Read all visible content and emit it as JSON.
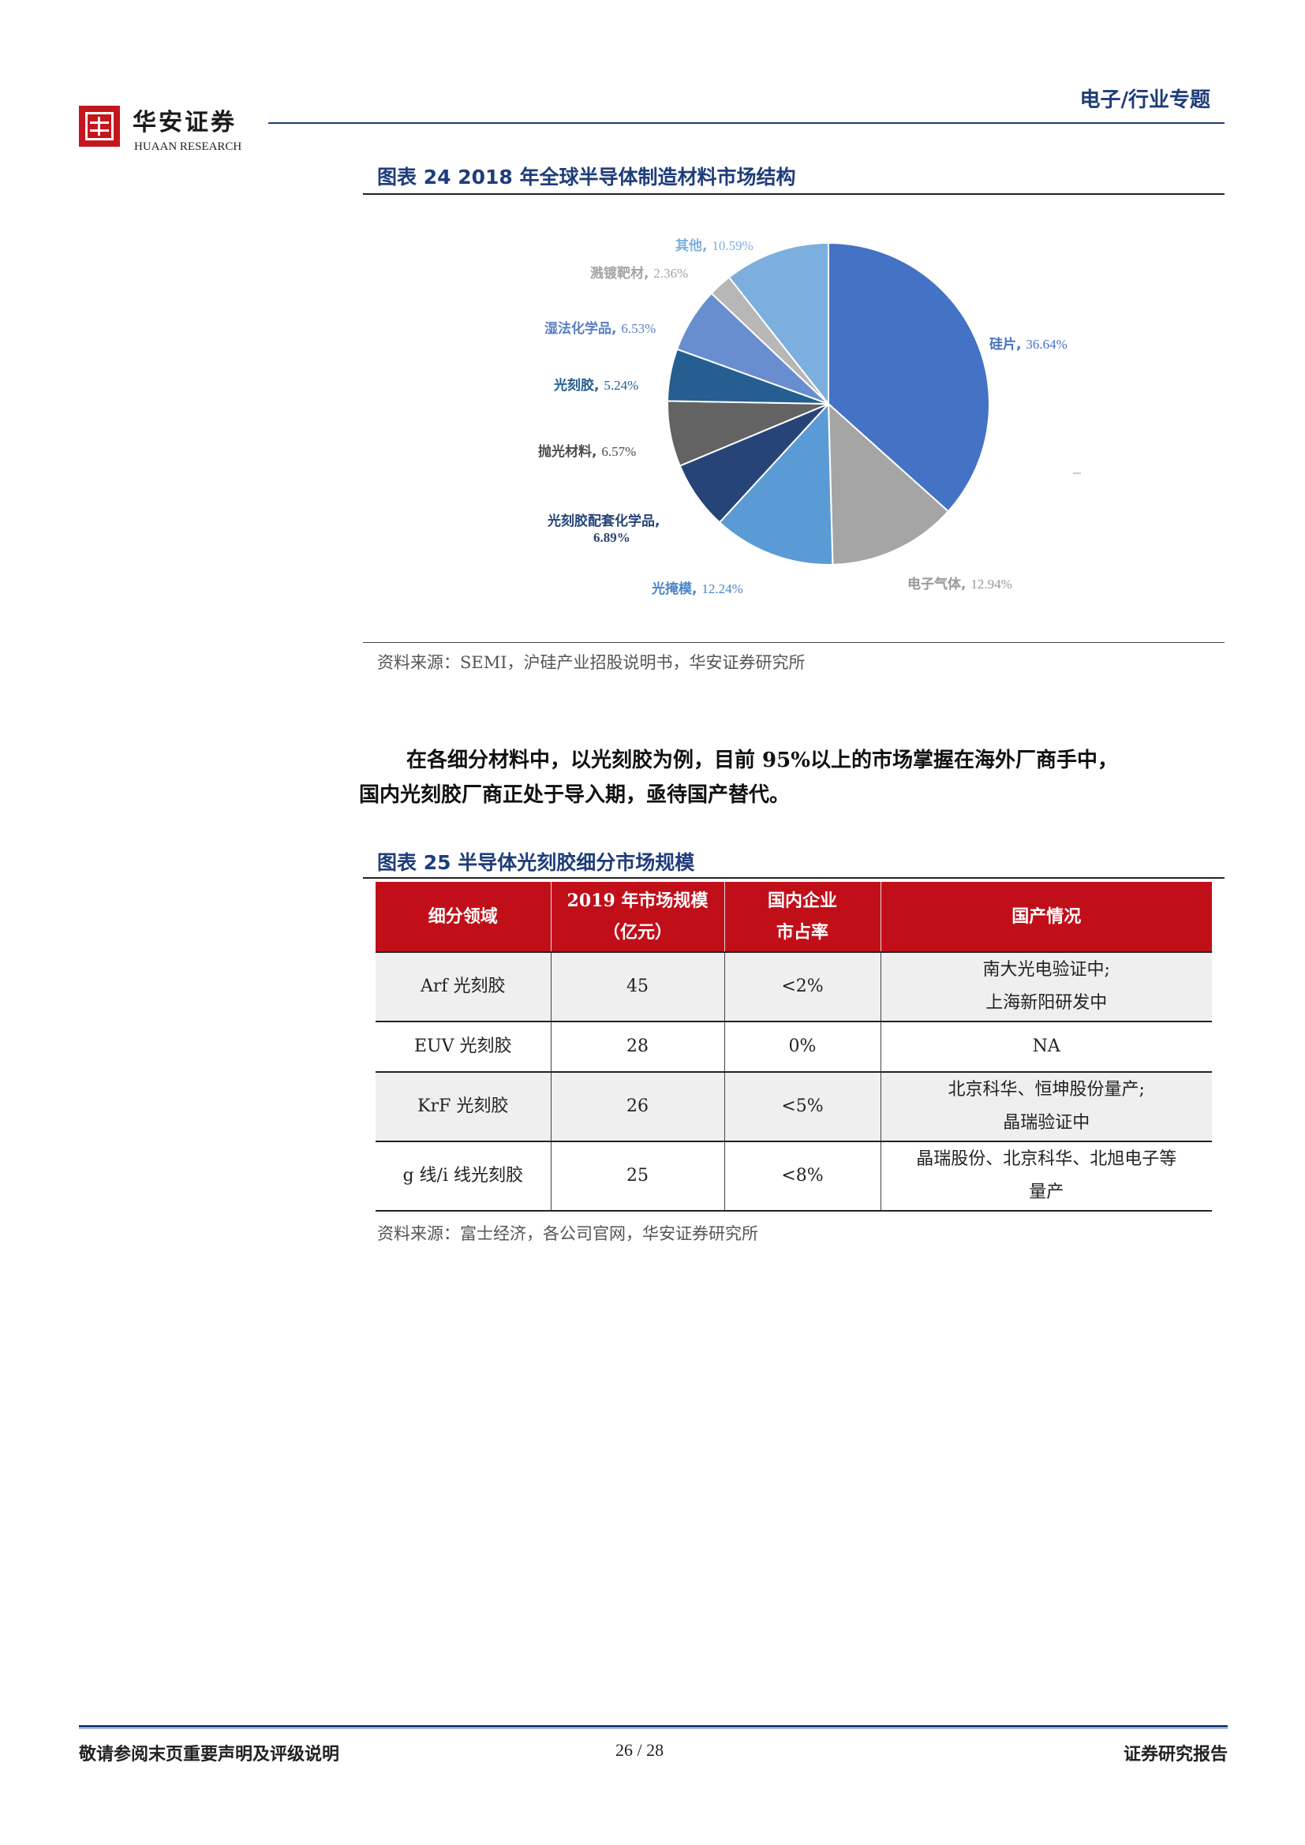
{
  "header": {
    "logo_cn": "华安证券",
    "logo_en": "HUAAN RESEARCH",
    "section": "电子/行业专题"
  },
  "figure24": {
    "title": "图表 24 2018 年全球半导体制造材料市场结构",
    "source": "资料来源：SEMI，沪硅产业招股说明书，华安证券研究所"
  },
  "chart_data": {
    "type": "pie",
    "title": "",
    "start_angle_deg": 0,
    "direction": "clockwise",
    "slices": [
      {
        "label": "硅片",
        "value": 36.64,
        "value_text": "36.64%",
        "color": "#4472c4"
      },
      {
        "label": "电子气体",
        "value": 12.94,
        "value_text": "12.94%",
        "color": "#a5a5a5"
      },
      {
        "label": "光掩模",
        "value": 12.24,
        "value_text": "12.24%",
        "color": "#5b9bd5"
      },
      {
        "label": "光刻胶配套化学品,",
        "value": 6.89,
        "value_text": "6.89%",
        "color": "#264478"
      },
      {
        "label": "抛光材料",
        "value": 6.57,
        "value_text": "6.57%",
        "color": "#636363"
      },
      {
        "label": "光刻胶",
        "value": 5.24,
        "value_text": "5.24%",
        "color": "#255e91"
      },
      {
        "label": "湿法化学品",
        "value": 6.53,
        "value_text": "6.53%",
        "color": "#698ed0"
      },
      {
        "label": "溅镀靶材",
        "value": 2.36,
        "value_text": "2.36%",
        "color": "#b7b7b7"
      },
      {
        "label": "其他",
        "value": 10.59,
        "value_text": "10.59%",
        "color": "#7cafdd"
      }
    ]
  },
  "paragraph": {
    "line1": "在各细分材料中，以光刻胶为例，目前 95%以上的市场掌握在海外厂商手中，",
    "line2": "国内光刻胶厂商正处于导入期，亟待国产替代。"
  },
  "figure25": {
    "title": "图表 25  半导体光刻胶细分市场规模",
    "source": "资料来源：富士经济，各公司官网，华安证券研究所",
    "headers": [
      [
        "细分领域"
      ],
      [
        "2019 年市场规模",
        "（亿元）"
      ],
      [
        "国内企业",
        "市占率"
      ],
      [
        "国产情况"
      ]
    ],
    "rows": [
      {
        "field": "Arf 光刻胶",
        "size": "45",
        "share": "<2%",
        "status": [
          "南大光电验证中;",
          "上海新阳研发中"
        ]
      },
      {
        "field": "EUV 光刻胶",
        "size": "28",
        "share": "0%",
        "status": [
          "NA"
        ]
      },
      {
        "field": "KrF 光刻胶",
        "size": "26",
        "share": "<5%",
        "status": [
          "北京科华、恒坤股份量产;",
          "晶瑞验证中"
        ]
      },
      {
        "field": "g 线/i  线光刻胶",
        "size": "25",
        "share": "<8%",
        "status": [
          "晶瑞股份、北京科华、北旭电子等",
          "量产"
        ]
      }
    ]
  },
  "footer": {
    "left": "敬请参阅末页重要声明及评级说明",
    "page": "26 / 28",
    "right": "证券研究报告"
  }
}
